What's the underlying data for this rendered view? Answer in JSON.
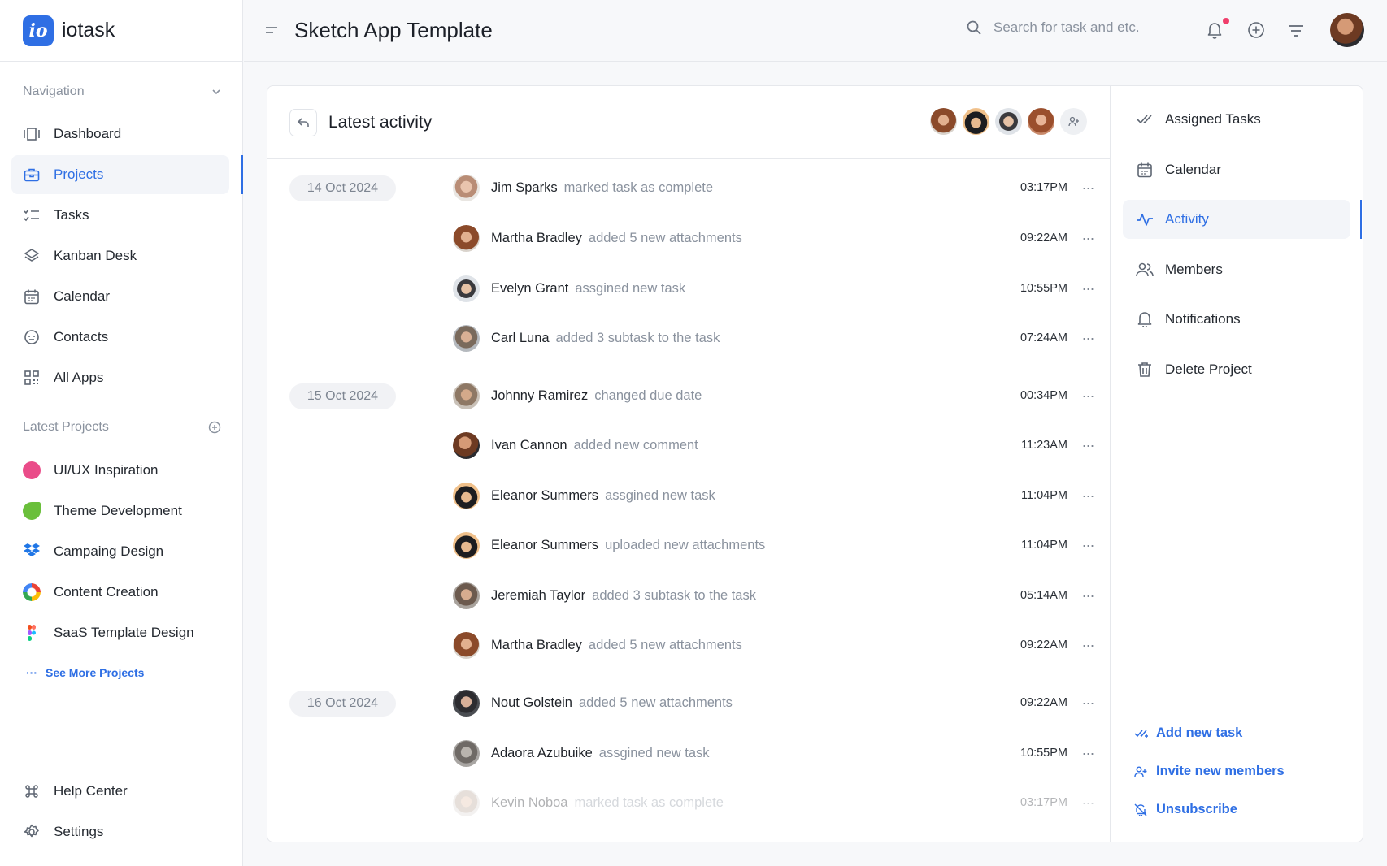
{
  "brand": {
    "logo_text": "io",
    "name": "iotask"
  },
  "sidebar": {
    "navigation_label": "Navigation",
    "nav": [
      {
        "label": "Dashboard",
        "icon": "dashboard-icon"
      },
      {
        "label": "Projects",
        "icon": "briefcase-icon"
      },
      {
        "label": "Tasks",
        "icon": "checklist-icon"
      },
      {
        "label": "Kanban Desk",
        "icon": "layers-icon"
      },
      {
        "label": "Calendar",
        "icon": "calendar-icon"
      },
      {
        "label": "Contacts",
        "icon": "smile-icon"
      },
      {
        "label": "All Apps",
        "icon": "apps-grid-icon"
      }
    ],
    "latest_projects_label": "Latest Projects",
    "projects": [
      {
        "label": "UI/UX Inspiration",
        "color": "#ea4c89"
      },
      {
        "label": "Theme Development",
        "color": "#6abf3b"
      },
      {
        "label": "Campaing Design",
        "color": "#1f76e6"
      },
      {
        "label": "Content Creation",
        "color": "#ea4335"
      },
      {
        "label": "SaaS Template Design",
        "color": "#f24e1e"
      }
    ],
    "see_more": "See More Projects",
    "footer": [
      {
        "label": "Help Center",
        "icon": "command-icon"
      },
      {
        "label": "Settings",
        "icon": "gear-icon"
      }
    ]
  },
  "header": {
    "title": "Sketch App Template",
    "search_placeholder": "Search for task and etc."
  },
  "activity": {
    "title": "Latest activity",
    "groups": [
      {
        "date": "14 Oct 2024",
        "items": [
          {
            "name": "Jim Sparks",
            "action": "marked task as complete",
            "time": "03:17PM"
          },
          {
            "name": "Martha Bradley",
            "action": "added 5 new attachments",
            "time": "09:22AM"
          },
          {
            "name": "Evelyn Grant",
            "action": "assgined new task",
            "time": "10:55PM"
          },
          {
            "name": "Carl Luna",
            "action": "added 3 subtask to the task",
            "time": "07:24AM"
          }
        ]
      },
      {
        "date": "15 Oct 2024",
        "items": [
          {
            "name": "Johnny Ramirez",
            "action": "changed due date",
            "time": "00:34PM"
          },
          {
            "name": "Ivan Cannon",
            "action": "added new comment",
            "time": "11:23AM"
          },
          {
            "name": "Eleanor Summers",
            "action": "assgined new task",
            "time": "11:04PM"
          },
          {
            "name": "Eleanor Summers",
            "action": "uploaded new attachments",
            "time": "11:04PM"
          },
          {
            "name": "Jeremiah Taylor",
            "action": "added 3 subtask to the task",
            "time": "05:14AM"
          },
          {
            "name": "Martha Bradley",
            "action": "added 5 new attachments",
            "time": "09:22AM"
          }
        ]
      },
      {
        "date": "16 Oct 2024",
        "items": [
          {
            "name": "Nout Golstein",
            "action": "added 5 new attachments",
            "time": "09:22AM"
          },
          {
            "name": "Adaora Azubuike",
            "action": "assgined new task",
            "time": "10:55PM"
          },
          {
            "name": "Kevin Noboa",
            "action": "marked task as complete",
            "time": "03:17PM"
          }
        ]
      }
    ]
  },
  "right_panel": {
    "menu": [
      {
        "label": "Assigned Tasks",
        "icon": "double-check-icon"
      },
      {
        "label": "Calendar",
        "icon": "calendar-icon"
      },
      {
        "label": "Activity",
        "icon": "activity-pulse-icon"
      },
      {
        "label": "Members",
        "icon": "members-icon"
      },
      {
        "label": "Notifications",
        "icon": "bell-icon"
      },
      {
        "label": "Delete Project",
        "icon": "trash-icon"
      }
    ],
    "links": [
      {
        "label": "Add new task",
        "icon": "add-task-icon"
      },
      {
        "label": "Invite new members",
        "icon": "invite-user-icon"
      },
      {
        "label": "Unsubscribe",
        "icon": "bell-off-icon"
      }
    ]
  },
  "colors": {
    "accent": "#2f6fe4",
    "notification_dot": "#f03e6b"
  }
}
